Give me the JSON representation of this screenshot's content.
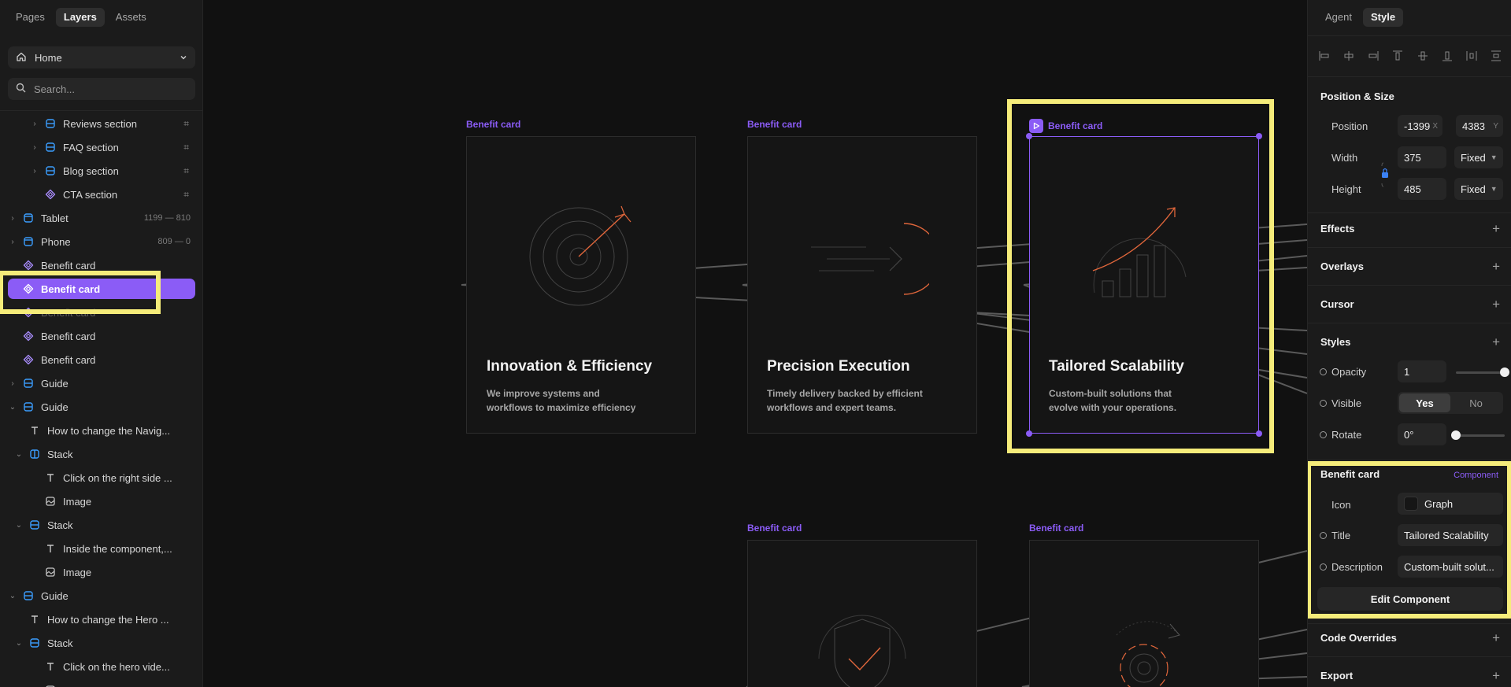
{
  "left_panel": {
    "tabs": [
      "Pages",
      "Layers",
      "Assets"
    ],
    "active_tab": "Layers",
    "page_select": "Home",
    "search_placeholder": "Search...",
    "layers": [
      {
        "name": "Reviews section",
        "icon": "stack-icon",
        "chevron": "›",
        "hash": "⌗"
      },
      {
        "name": "FAQ section",
        "icon": "stack-icon",
        "chevron": "›",
        "hash": "⌗"
      },
      {
        "name": "Blog section",
        "icon": "stack-icon",
        "chevron": "›",
        "hash": "⌗"
      },
      {
        "name": "CTA section",
        "icon": "component-icon",
        "chevron": "",
        "hash": "⌗"
      },
      {
        "name": "Tablet",
        "icon": "breakpoint-icon",
        "chevron": "›",
        "meta": "1199 — 810"
      },
      {
        "name": "Phone",
        "icon": "breakpoint-icon",
        "chevron": "›",
        "meta": "809 — 0"
      },
      {
        "name": "Benefit card",
        "icon": "component-icon",
        "chevron": ""
      },
      {
        "name": "Benefit card",
        "icon": "component-icon",
        "chevron": "",
        "selected": true
      },
      {
        "name": "Benefit card",
        "icon": "component-icon",
        "chevron": "",
        "faded": true
      },
      {
        "name": "Benefit card",
        "icon": "component-icon",
        "chevron": ""
      },
      {
        "name": "Benefit card",
        "icon": "component-icon",
        "chevron": ""
      },
      {
        "name": "Guide",
        "icon": "stack-icon",
        "chevron": "›"
      },
      {
        "name": "Guide",
        "icon": "stack-icon",
        "chevron": "⌄"
      },
      {
        "name": "How to change the Navig...",
        "icon": "text-icon",
        "chevron": ""
      },
      {
        "name": "Stack",
        "icon": "stack-horizontal-icon",
        "chevron": "⌄"
      },
      {
        "name": "Click on the right side ...",
        "icon": "text-icon",
        "chevron": ""
      },
      {
        "name": "Image",
        "icon": "image-icon",
        "chevron": ""
      },
      {
        "name": "Stack",
        "icon": "stack-icon",
        "chevron": "⌄"
      },
      {
        "name": "Inside the component,...",
        "icon": "text-icon",
        "chevron": ""
      },
      {
        "name": "Image",
        "icon": "image-icon",
        "chevron": ""
      },
      {
        "name": "Guide",
        "icon": "stack-icon",
        "chevron": "⌄"
      },
      {
        "name": "How to change the Hero ...",
        "icon": "text-icon",
        "chevron": ""
      },
      {
        "name": "Stack",
        "icon": "stack-icon",
        "chevron": "⌄"
      },
      {
        "name": "Click on the hero vide...",
        "icon": "text-icon",
        "chevron": ""
      },
      {
        "name": "Image",
        "icon": "image-icon",
        "chevron": ""
      }
    ]
  },
  "canvas": {
    "frame_label": "Benefit card",
    "cards": [
      {
        "title": "Innovation & Efficiency",
        "desc_1": "We improve systems and",
        "desc_2": "workflows to maximize efficiency"
      },
      {
        "title": "Precision Execution",
        "desc_1": "Timely delivery backed by efficient",
        "desc_2": "workflows and expert teams."
      },
      {
        "title": "Tailored Scalability",
        "desc_1": "Custom-built solutions that",
        "desc_2": "evolve with your operations."
      }
    ],
    "accent": "#8b5cf6",
    "icon_stroke": "#e0663b"
  },
  "right_panel": {
    "tabs": [
      "Agent",
      "Style"
    ],
    "active_tab": "Style",
    "position_size": {
      "title": "Position & Size",
      "position_label": "Position",
      "x": "-1399",
      "x_axis": "X",
      "y": "4383",
      "y_axis": "Y",
      "width_label": "Width",
      "width": "375",
      "width_mode": "Fixed",
      "height_label": "Height",
      "height": "485",
      "height_mode": "Fixed"
    },
    "sections": {
      "effects": "Effects",
      "overlays": "Overlays",
      "cursor": "Cursor",
      "styles": "Styles",
      "code_overrides": "Code Overrides",
      "export": "Export"
    },
    "styles": {
      "opacity_label": "Opacity",
      "opacity": "1",
      "opacity_fraction": 1.0,
      "visible_label": "Visible",
      "visible_yes": "Yes",
      "visible_no": "No",
      "rotate_label": "Rotate",
      "rotate": "0°",
      "rotate_fraction": 0.0
    },
    "component": {
      "title": "Benefit card",
      "tag": "Component",
      "icon_label": "Icon",
      "icon_value": "Graph",
      "title_label": "Title",
      "title_value": "Tailored Scalability",
      "description_label": "Description",
      "description_value": "Custom-built solut...",
      "edit_button": "Edit Component"
    }
  }
}
